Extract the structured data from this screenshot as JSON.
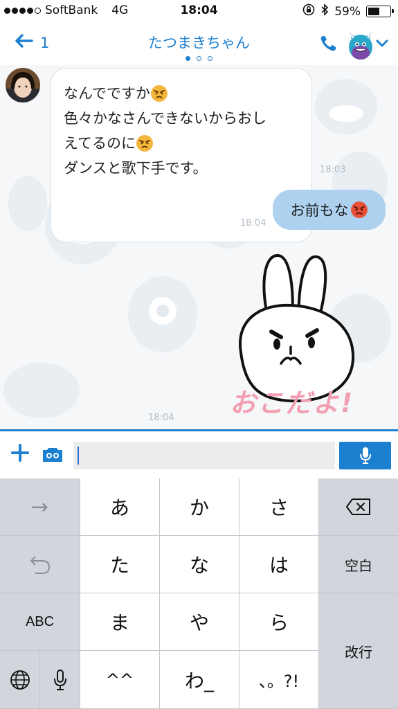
{
  "status_bar": {
    "carrier": "SoftBank",
    "network": "4G",
    "time": "18:04",
    "battery_percent": "59%",
    "battery_level": 0.59
  },
  "nav": {
    "back_count": "1",
    "title": "たつまきちゃん",
    "page_count": 3,
    "page_active": 0,
    "accent_color": "#1c7fd0"
  },
  "messages": [
    {
      "direction": "incoming",
      "lines": [
        {
          "text": "なんでですか",
          "emoji": "angry-face"
        },
        {
          "text": "色々かなさんできないからおし"
        },
        {
          "text": "えてるのに",
          "emoji": "angry-face"
        },
        {
          "text": "ダンスと歌下手です。"
        }
      ],
      "time": "18:03"
    },
    {
      "direction": "outgoing",
      "text": "お前もな",
      "emoji": "pouting-face",
      "time": "18:04"
    },
    {
      "direction": "outgoing",
      "type": "sticker",
      "sticker_text": "おこだよ!",
      "time": "18:04"
    }
  ],
  "input": {
    "value": "",
    "plus_icon": "plus-icon",
    "camera_icon": "camera-icon",
    "mic_icon": "microphone-icon"
  },
  "keyboard": {
    "next_arrow": "→",
    "keys_row1": [
      "あ",
      "か",
      "さ"
    ],
    "keys_row2": [
      "た",
      "な",
      "は"
    ],
    "keys_row3": [
      "ま",
      "や",
      "ら"
    ],
    "keys_row4": [
      "^^",
      "わ_",
      "、。?!"
    ],
    "abc_label": "ABC",
    "space_label": "空白",
    "return_label": "改行"
  }
}
